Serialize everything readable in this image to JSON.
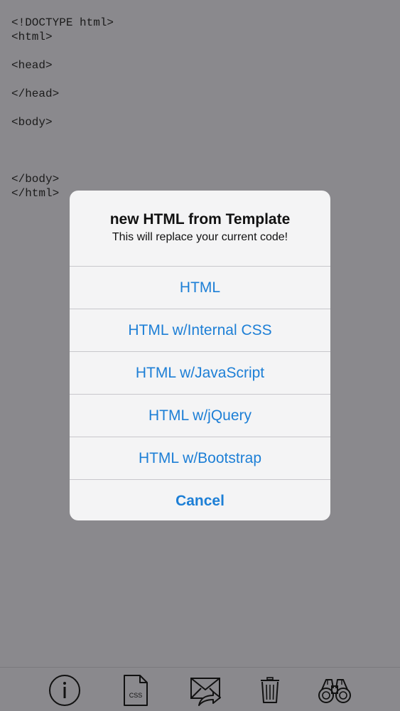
{
  "editor": {
    "code_lines": [
      "<!DOCTYPE html>",
      "<html>",
      "",
      "<head>",
      "",
      "</head>",
      "",
      "<body>",
      "",
      "",
      "",
      "</body>",
      "</html>"
    ]
  },
  "alert": {
    "title": "new HTML from Template",
    "message": "This will replace your current code!",
    "options": [
      {
        "label": "HTML"
      },
      {
        "label": "HTML w/Internal CSS"
      },
      {
        "label": "HTML w/JavaScript"
      },
      {
        "label": "HTML w/jQuery"
      },
      {
        "label": "HTML w/Bootstrap"
      }
    ],
    "cancel_label": "Cancel"
  },
  "toolbar": {
    "items": [
      {
        "icon": "info-icon"
      },
      {
        "icon": "css-file-icon",
        "icon_text": "CSS"
      },
      {
        "icon": "mail-share-icon"
      },
      {
        "icon": "trash-icon"
      },
      {
        "icon": "binoculars-icon"
      }
    ]
  },
  "colors": {
    "background": "#8a898d",
    "alert_background": "#f4f4f5",
    "accent": "#1d7fd6",
    "separator": "#c8c7cc"
  }
}
